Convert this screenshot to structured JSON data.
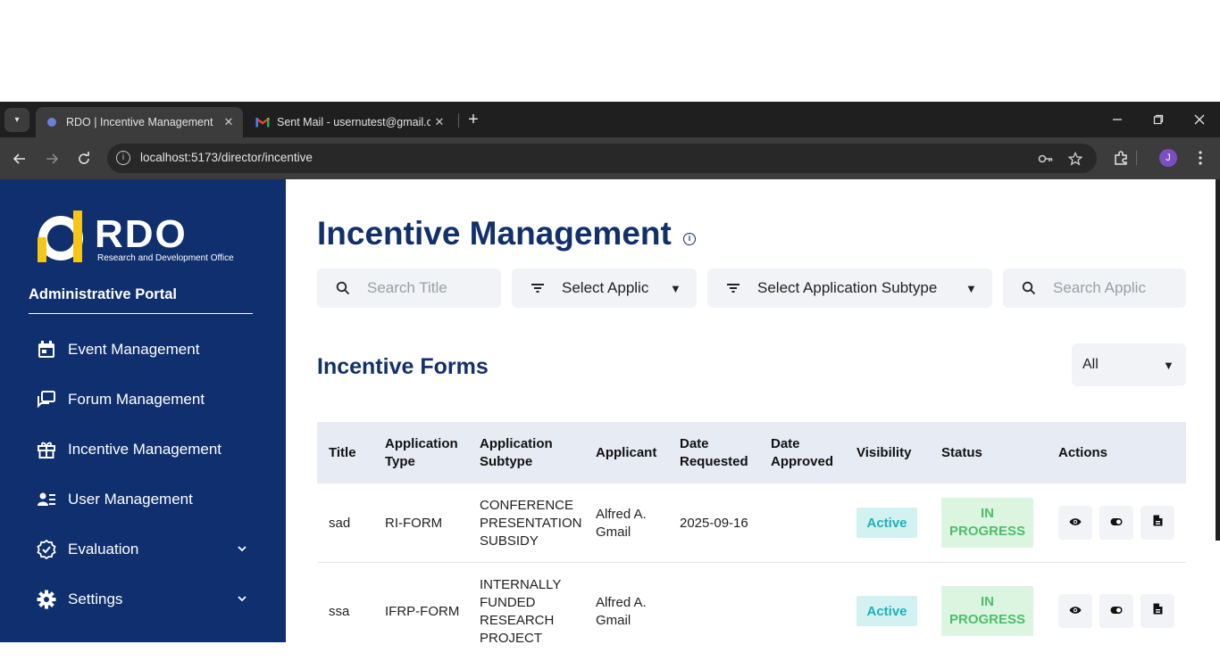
{
  "browser": {
    "tabs": [
      {
        "title": "RDO | Incentive Management",
        "active": true,
        "icon": "rdo-favicon"
      },
      {
        "title": "Sent Mail - usernutest@gmail.c",
        "active": false,
        "icon": "gmail-icon"
      }
    ],
    "url": "localhost:5173/director/incentive",
    "profile_initial": "J"
  },
  "sidebar": {
    "logo_text": "RDO",
    "logo_subtext": "Research and Development Office",
    "portal_title": "Administrative Portal",
    "items": [
      {
        "label": "Event Management",
        "icon": "calendar-icon"
      },
      {
        "label": "Forum Management",
        "icon": "forum-icon"
      },
      {
        "label": "Incentive Management",
        "icon": "gift-icon"
      },
      {
        "label": "User Management",
        "icon": "user-list-icon"
      },
      {
        "label": "Evaluation",
        "icon": "badge-check-icon",
        "expandable": true
      },
      {
        "label": "Settings",
        "icon": "gear-icon",
        "expandable": true
      }
    ]
  },
  "main": {
    "title": "Incentive Management",
    "filters": {
      "search_title_placeholder": "Search Title",
      "application_type": "Select Applic",
      "application_subtype": "Select Application Subtype",
      "search_applicant_placeholder": "Search Applic"
    },
    "section_title": "Incentive Forms",
    "status_filter": "All",
    "table": {
      "headers": [
        "Title",
        "Application Type",
        "Application Subtype",
        "Applicant",
        "Date Requested",
        "Date Approved",
        "Visibility",
        "Status",
        "Actions"
      ],
      "rows": [
        {
          "title": "sad",
          "type": "RI-FORM",
          "subtype": "CONFERENCE PRESENTATION SUBSIDY",
          "applicant": "Alfred A. Gmail",
          "date_requested": "2025-09-16",
          "date_approved": "",
          "visibility": "Active",
          "status": "IN PROGRESS"
        },
        {
          "title": "ssa",
          "type": "IFRP-FORM",
          "subtype": "INTERNALLY FUNDED RESEARCH PROJECT",
          "applicant": "Alfred A. Gmail",
          "date_requested": "",
          "date_approved": "",
          "visibility": "Active",
          "status": "IN PROGRESS"
        }
      ]
    }
  },
  "colors": {
    "sidebar_bg": "#0f2f6e",
    "heading": "#12306b",
    "visibility_text": "#1bb2b7",
    "status_text": "#4dbf68",
    "logo_accent": "#f5c518"
  }
}
